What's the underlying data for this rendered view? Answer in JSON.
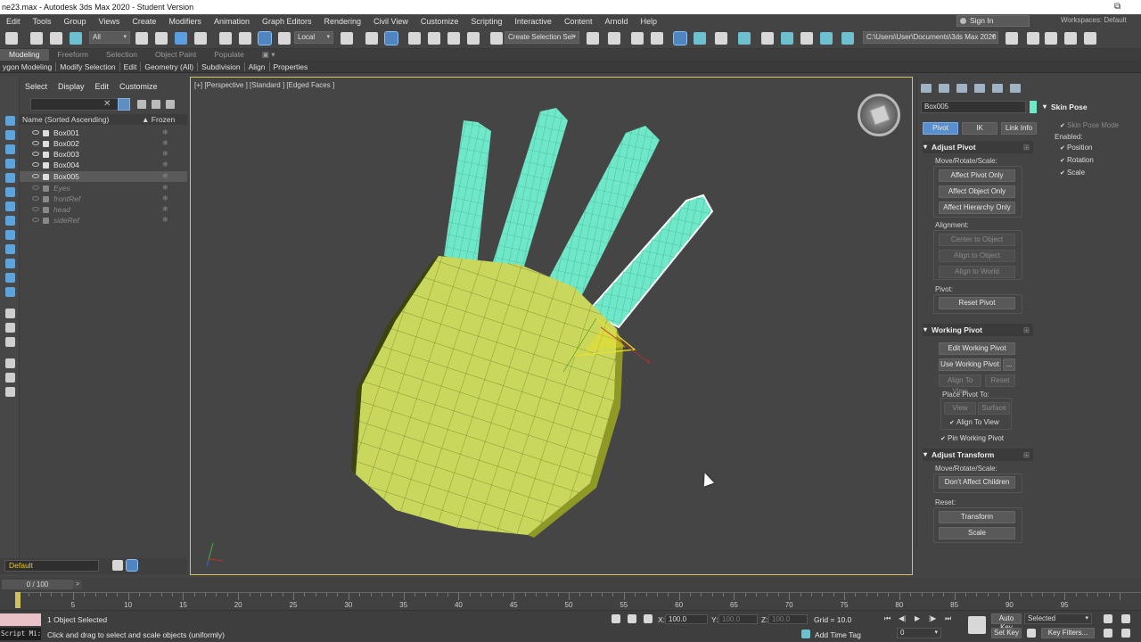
{
  "titlebar": {
    "title": "ne23.max - Autodesk 3ds Max 2020 - Student Version",
    "restore_glyph": "⧉"
  },
  "menu": {
    "items": [
      "Edit",
      "Tools",
      "Group",
      "Views",
      "Create",
      "Modifiers",
      "Animation",
      "Graph Editors",
      "Rendering",
      "Civil View",
      "Customize",
      "Scripting",
      "Interactive",
      "Content",
      "Arnold",
      "Help"
    ],
    "signin": "Sign In",
    "workspaces_label": "Workspaces:",
    "workspace_value": "Default"
  },
  "toolbar": {
    "filter_value": "All",
    "coord_system": "Local",
    "selection_set": "Create Selection Sel",
    "project_path": "C:\\Users\\User\\Documents\\3ds Max 2020"
  },
  "ribbon": {
    "tabs": [
      "Modeling",
      "Freeform",
      "Selection",
      "Object Paint",
      "Populate"
    ],
    "active_tab": "Modeling",
    "panels": [
      "ygon Modeling",
      "Modify Selection",
      "Edit",
      "Geometry (All)",
      "Subdivision",
      "Align",
      "Properties"
    ]
  },
  "scene_explorer": {
    "tabs": [
      "Select",
      "Display",
      "Edit",
      "Customize"
    ],
    "column_name": "Name (Sorted Ascending)",
    "column_frozen": "Frozen",
    "sort_arrow": "▲",
    "clear_glyph": "✕",
    "frozen_glyph": "❄",
    "rows": [
      {
        "name": "Box001",
        "ref": false,
        "selected": false
      },
      {
        "name": "Box002",
        "ref": false,
        "selected": false
      },
      {
        "name": "Box003",
        "ref": false,
        "selected": false
      },
      {
        "name": "Box004",
        "ref": false,
        "selected": false
      },
      {
        "name": "Box005",
        "ref": false,
        "selected": true
      },
      {
        "name": "Eyes",
        "ref": true,
        "selected": false
      },
      {
        "name": "frontRef",
        "ref": true,
        "selected": false
      },
      {
        "name": "head",
        "ref": true,
        "selected": false
      },
      {
        "name": "sideRef",
        "ref": true,
        "selected": false
      }
    ],
    "layer": "Default"
  },
  "viewport": {
    "label": "[+] [Perspective ] [Standard ] [Edged Faces ]",
    "border_color": "#d7c458",
    "palm_color": "#c9d85c",
    "finger_color": "#6ee8c8",
    "axis_x": "x"
  },
  "command_panel": {
    "object_name": "Box005",
    "object_color": "#6ee8c8",
    "tabs": {
      "pivot": "Pivot",
      "ik": "IK",
      "link_info": "Link Info"
    },
    "adjust_pivot": {
      "title": "Adjust Pivot",
      "move_label": "Move/Rotate/Scale:",
      "affect_pivot": "Affect Pivot Only",
      "affect_object": "Affect Object Only",
      "affect_hierarchy": "Affect Hierarchy Only",
      "alignment_label": "Alignment:",
      "center": "Center to Object",
      "align_object": "Align to Object",
      "align_world": "Align to World",
      "pivot_label": "Pivot:",
      "reset_pivot": "Reset Pivot"
    },
    "working_pivot": {
      "title": "Working Pivot",
      "edit": "Edit Working Pivot",
      "use": "Use Working Pivot",
      "more": "...",
      "align_view": "Align To View",
      "reset": "Reset",
      "place_label": "Place Pivot To:",
      "view": "View",
      "surface": "Surface",
      "align_to_view_chk": "Align To View",
      "pin": "Pin Working Pivot"
    },
    "adjust_transform": {
      "title": "Adjust Transform",
      "move_label": "Move/Rotate/Scale:",
      "dont_affect": "Don't Affect Children",
      "reset_label": "Reset:",
      "transform": "Transform",
      "scale": "Scale"
    },
    "pin_glyph": "⊞"
  },
  "skin_pose": {
    "title": "Skin Pose",
    "mode": "Skin Pose Mode",
    "enabled_label": "Enabled:",
    "position": "Position",
    "rotation": "Rotation",
    "scale": "Scale"
  },
  "timeline": {
    "frame": "0 / 100",
    "arrow": ">",
    "ticks": [
      0,
      5,
      10,
      15,
      20,
      25,
      30,
      35,
      40,
      45,
      50,
      55,
      60,
      65,
      70,
      75,
      80,
      85,
      90,
      95
    ],
    "current": 0,
    "total": 100
  },
  "status": {
    "selected": "1 Object Selected",
    "prompt": "Click and drag to select and scale objects (uniformly)",
    "maxscript": "Script Mi:",
    "x_label": "X:",
    "x_value": "100.0",
    "y_label": "Y:",
    "y_value": "100.0",
    "z_label": "Z:",
    "z_value": "100.0",
    "grid": "Grid = 10.0",
    "add_time_tag": "Add Time Tag",
    "frame_value": "0",
    "auto_key": "Auto Key",
    "selected_dd": "Selected",
    "set_key": "Set Key",
    "key_filters": "Key Filters...",
    "play_controls": {
      "start": "⏮",
      "prev": "◀|",
      "play": "▶",
      "next": "|▶",
      "end": "⏭"
    }
  }
}
